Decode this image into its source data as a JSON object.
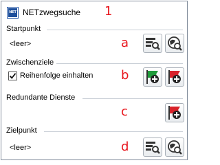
{
  "window": {
    "title": "NETzwegsuche",
    "icon_text": "NET",
    "marker": "1"
  },
  "startpunkt": {
    "label": "Startpunkt",
    "value": "<leer>",
    "marker": "a",
    "buttons": [
      "search-table-icon",
      "find-feature-icon"
    ]
  },
  "zwischenziele": {
    "label": "Zwischenziele",
    "checkbox_label": "Reihenfolge einhalten",
    "checked": true,
    "marker": "b",
    "buttons": [
      "add-green-flag-icon",
      "add-red-flag-icon"
    ]
  },
  "redundante_dienste": {
    "label": "Redundante Dienste",
    "marker": "c",
    "buttons": [
      "add-red-flag-icon"
    ]
  },
  "zielpunkt": {
    "label": "Zielpunkt",
    "value": "<leer>",
    "marker": "d",
    "buttons": [
      "search-table-icon",
      "find-feature-icon"
    ]
  },
  "colors": {
    "marker": "#e8141b",
    "green_flag": "#1f9a3a",
    "red_flag": "#d7222a",
    "icon_dark": "#333333",
    "net_blue": "#1d4f9c"
  }
}
